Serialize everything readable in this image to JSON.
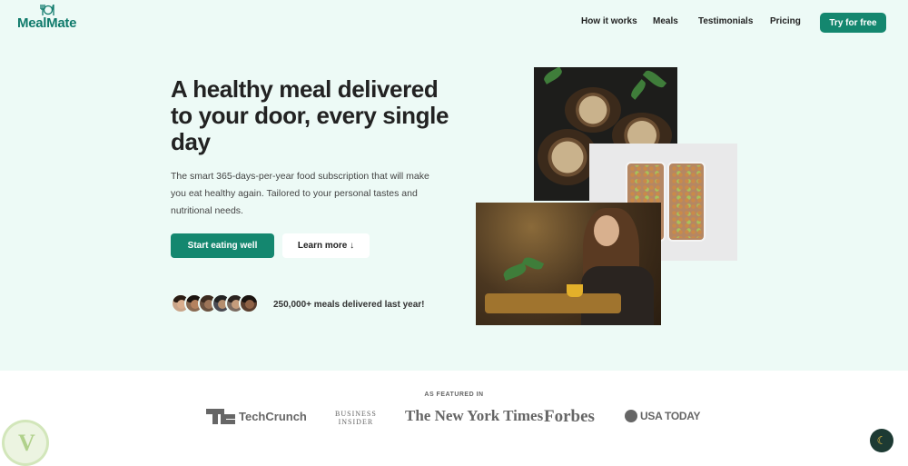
{
  "brand": {
    "name": "MealMate"
  },
  "nav": {
    "how_it_works": "How it works",
    "meals": "Meals",
    "testimonials": "Testimonials",
    "pricing": "Pricing",
    "cta": "Try for free"
  },
  "hero": {
    "headline": "A healthy meal delivered to your door, every single day",
    "description": "The smart 365-days-per-year food subscription that will make you eat healthy again. Tailored to your personal tastes and nutritional needs.",
    "primary_cta": "Start eating well",
    "secondary_cta": "Learn more ↓",
    "delivered_text": "250,000+ meals delivered last year!"
  },
  "featured": {
    "label": "AS FEATURED IN",
    "logos": {
      "techcrunch": "TechCrunch",
      "business_insider_line1": "BUSINESS",
      "business_insider_line2": "INSIDER",
      "nyt": "The New York Times",
      "forbes": "Forbes",
      "usa_today": "USA TODAY"
    }
  },
  "colors": {
    "accent": "#14876f",
    "hero_background": "#edfaf6"
  },
  "icons": {
    "theme_toggle": "moon-icon",
    "logo": "fork-knife-icon"
  }
}
